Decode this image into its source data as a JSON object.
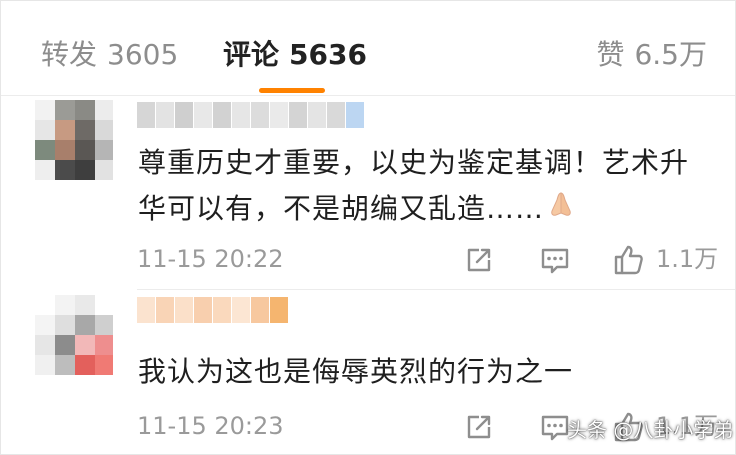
{
  "tabs": {
    "repost": {
      "label": "转发",
      "count": "3605"
    },
    "comments": {
      "label": "评论",
      "count": "5636"
    },
    "likes": {
      "label": "赞",
      "count": "6.5万"
    }
  },
  "colors": {
    "accent": "#ff8200",
    "text_primary": "#1f1f1f",
    "text_secondary": "#9a9a9a",
    "divider": "#ececec"
  },
  "comments": [
    {
      "text": "尊重历史才重要，以史为鉴定基调！艺术升华可以有，不是胡编又乱造……",
      "emoji": "folded-hands-emoji",
      "time": "11-15 20:22",
      "likes": "1.1万",
      "icons": [
        "share-icon",
        "reply-icon",
        "like-icon"
      ]
    },
    {
      "text": "我认为这也是侮辱英烈的行为之一",
      "time": "11-15 20:23",
      "likes": "1.1万",
      "icons": [
        "share-icon",
        "reply-icon",
        "like-icon"
      ]
    }
  ],
  "watermark": "头条 @八卦小学弟"
}
